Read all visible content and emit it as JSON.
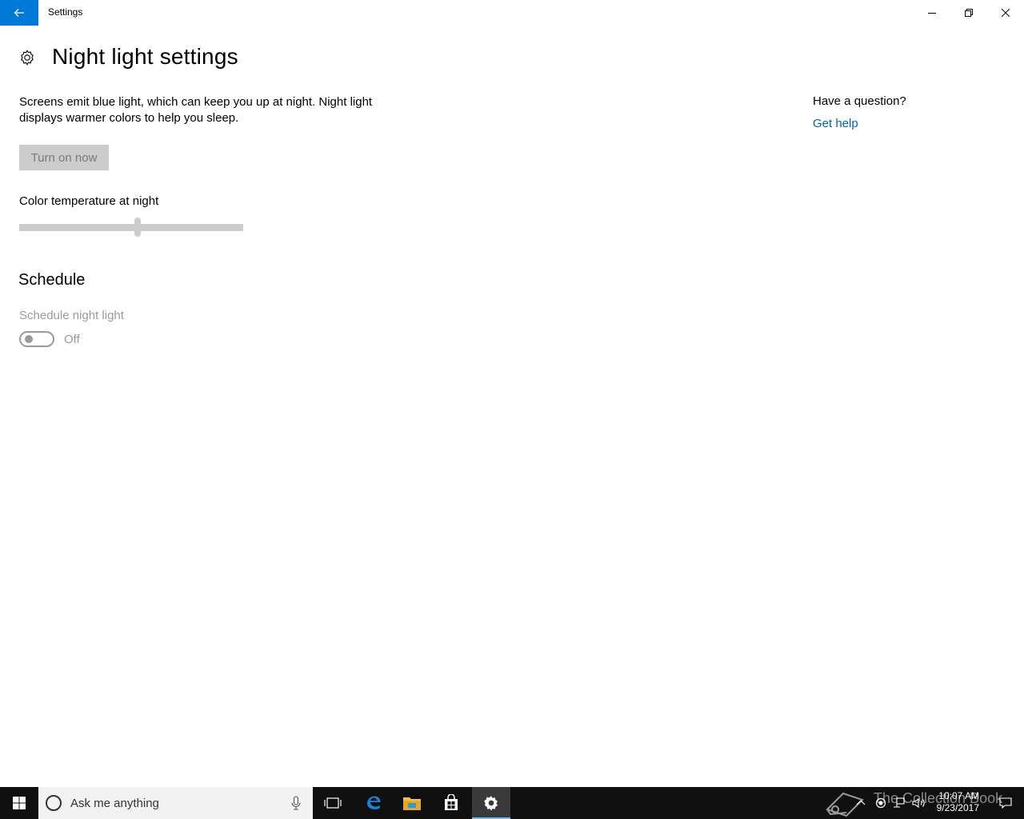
{
  "window": {
    "title": "Settings",
    "back_icon": "back-arrow-icon",
    "controls": [
      "minimize-icon",
      "restore-icon",
      "close-icon"
    ]
  },
  "page": {
    "title": "Night light settings",
    "header_icon": "gear-icon",
    "description": "Screens emit blue light, which can keep you up at night. Night light displays warmer colors to help you sleep.",
    "turn_on_button": "Turn on now",
    "slider": {
      "label": "Color temperature at night",
      "value_fraction": 0.53
    },
    "schedule": {
      "heading": "Schedule",
      "toggle_label": "Schedule night light",
      "toggle_state": "Off"
    }
  },
  "help": {
    "question": "Have a question?",
    "link": "Get help"
  },
  "taskbar": {
    "search_placeholder": "Ask me anything",
    "apps": [
      "windows-start-icon",
      "task-view-icon",
      "edge-icon",
      "file-explorer-icon",
      "store-icon",
      "settings-gear-icon"
    ],
    "watermark": "The Collection Book",
    "time": "10:07 AM",
    "date": "9/23/2017"
  },
  "colors": {
    "accent": "#0078d7",
    "link": "#0063b1",
    "disabled": "#9a9a9a",
    "taskbar": "#101010"
  }
}
